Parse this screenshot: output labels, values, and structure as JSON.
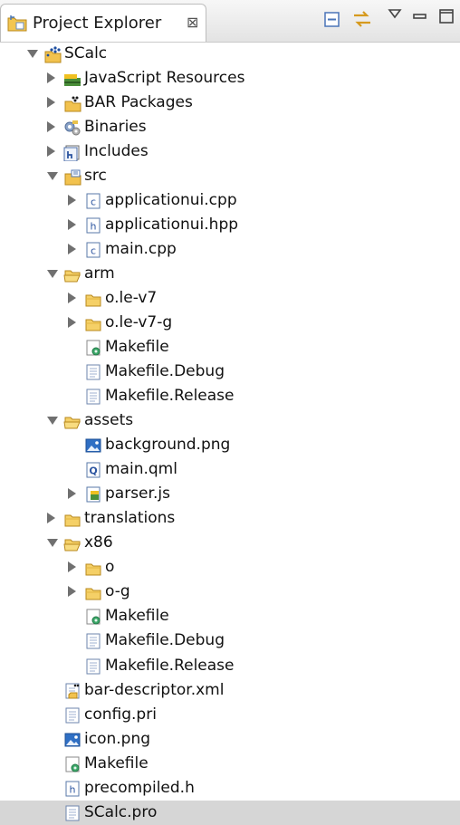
{
  "view": {
    "title": "Project Explorer",
    "close_glyph": "⊠",
    "toolbar": [
      {
        "name": "collapse-all-icon"
      },
      {
        "name": "link-with-editor-icon"
      },
      {
        "name": "view-menu-icon"
      },
      {
        "name": "minimize-icon"
      },
      {
        "name": "maximize-icon"
      }
    ]
  },
  "tree": [
    {
      "label": "SCalc",
      "depth": 0,
      "twisty": "open",
      "icon": "bb-project-icon"
    },
    {
      "label": "JavaScript Resources",
      "depth": 1,
      "twisty": "closed",
      "icon": "javascript-resources-icon"
    },
    {
      "label": "BAR Packages",
      "depth": 1,
      "twisty": "closed",
      "icon": "bar-packages-icon"
    },
    {
      "label": "Binaries",
      "depth": 1,
      "twisty": "closed",
      "icon": "binaries-icon"
    },
    {
      "label": "Includes",
      "depth": 1,
      "twisty": "closed",
      "icon": "includes-icon"
    },
    {
      "label": "src",
      "depth": 1,
      "twisty": "open",
      "icon": "source-folder-icon"
    },
    {
      "label": "applicationui.cpp",
      "depth": 2,
      "twisty": "closed",
      "icon": "cpp-file-icon"
    },
    {
      "label": "applicationui.hpp",
      "depth": 2,
      "twisty": "closed",
      "icon": "header-file-icon"
    },
    {
      "label": "main.cpp",
      "depth": 2,
      "twisty": "closed",
      "icon": "cpp-file-icon"
    },
    {
      "label": "arm",
      "depth": 1,
      "twisty": "open",
      "icon": "folder-open-icon"
    },
    {
      "label": "o.le-v7",
      "depth": 2,
      "twisty": "closed",
      "icon": "folder-icon"
    },
    {
      "label": "o.le-v7-g",
      "depth": 2,
      "twisty": "closed",
      "icon": "folder-icon"
    },
    {
      "label": "Makefile",
      "depth": 2,
      "twisty": "none",
      "icon": "makefile-icon"
    },
    {
      "label": "Makefile.Debug",
      "depth": 2,
      "twisty": "none",
      "icon": "text-file-icon"
    },
    {
      "label": "Makefile.Release",
      "depth": 2,
      "twisty": "none",
      "icon": "text-file-icon"
    },
    {
      "label": "assets",
      "depth": 1,
      "twisty": "open",
      "icon": "folder-open-icon"
    },
    {
      "label": "background.png",
      "depth": 2,
      "twisty": "none",
      "icon": "image-file-icon"
    },
    {
      "label": "main.qml",
      "depth": 2,
      "twisty": "none",
      "icon": "qml-file-icon"
    },
    {
      "label": "parser.js",
      "depth": 2,
      "twisty": "closed",
      "icon": "js-file-icon"
    },
    {
      "label": "translations",
      "depth": 1,
      "twisty": "closed",
      "icon": "folder-icon"
    },
    {
      "label": "x86",
      "depth": 1,
      "twisty": "open",
      "icon": "folder-open-icon"
    },
    {
      "label": "o",
      "depth": 2,
      "twisty": "closed",
      "icon": "folder-icon"
    },
    {
      "label": "o-g",
      "depth": 2,
      "twisty": "closed",
      "icon": "folder-icon"
    },
    {
      "label": "Makefile",
      "depth": 2,
      "twisty": "none",
      "icon": "makefile-icon"
    },
    {
      "label": "Makefile.Debug",
      "depth": 2,
      "twisty": "none",
      "icon": "text-file-icon"
    },
    {
      "label": "Makefile.Release",
      "depth": 2,
      "twisty": "none",
      "icon": "text-file-icon"
    },
    {
      "label": "bar-descriptor.xml",
      "depth": 1,
      "twisty": "none",
      "icon": "bar-descriptor-icon"
    },
    {
      "label": "config.pri",
      "depth": 1,
      "twisty": "none",
      "icon": "text-file-icon"
    },
    {
      "label": "icon.png",
      "depth": 1,
      "twisty": "none",
      "icon": "image-file-icon"
    },
    {
      "label": "Makefile",
      "depth": 1,
      "twisty": "none",
      "icon": "makefile-icon"
    },
    {
      "label": "precompiled.h",
      "depth": 1,
      "twisty": "none",
      "icon": "header-file-icon"
    },
    {
      "label": "SCalc.pro",
      "depth": 1,
      "twisty": "none",
      "icon": "text-file-icon",
      "selected": true
    }
  ]
}
